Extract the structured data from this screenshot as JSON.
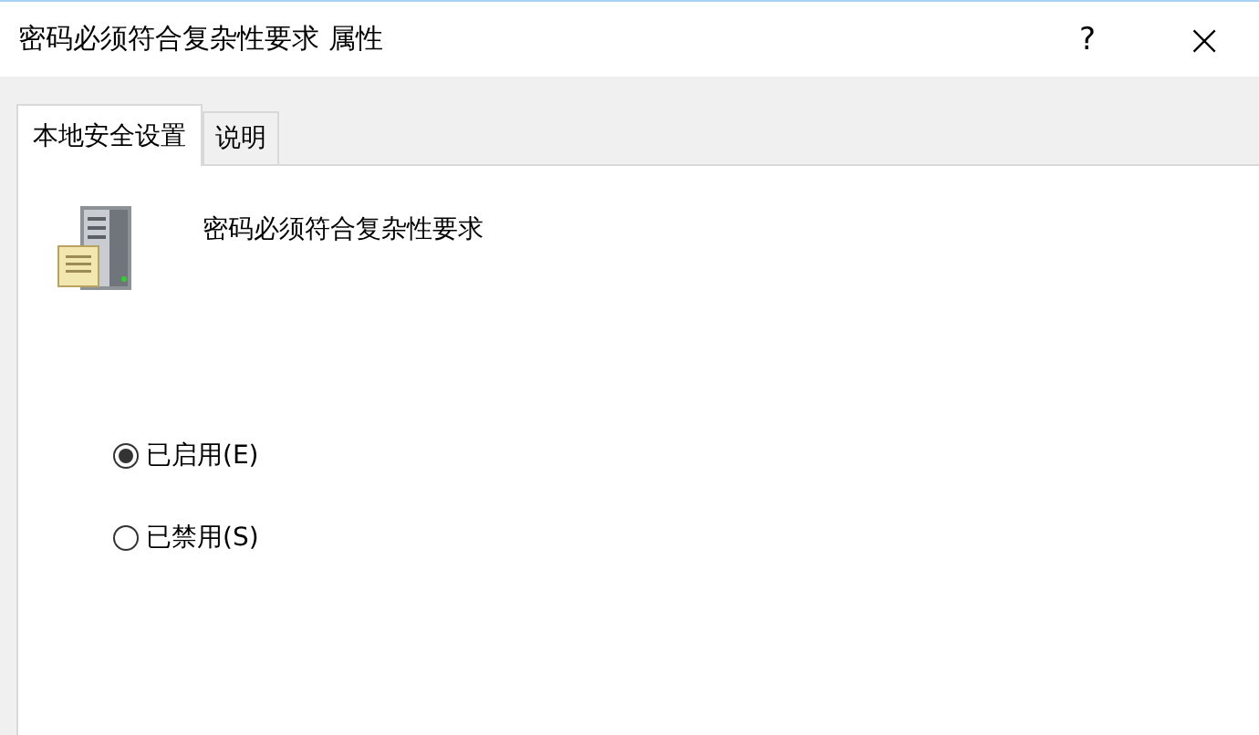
{
  "window": {
    "title": "密码必须符合复杂性要求 属性",
    "help": "?",
    "close": "×"
  },
  "tabs": [
    {
      "label": "本地安全设置",
      "selected": true
    },
    {
      "label": "说明",
      "selected": false
    }
  ],
  "policy": {
    "name": "密码必须符合复杂性要求"
  },
  "options": [
    {
      "label": "已启用(E)",
      "selected": true
    },
    {
      "label": "已禁用(S)",
      "selected": false
    }
  ]
}
